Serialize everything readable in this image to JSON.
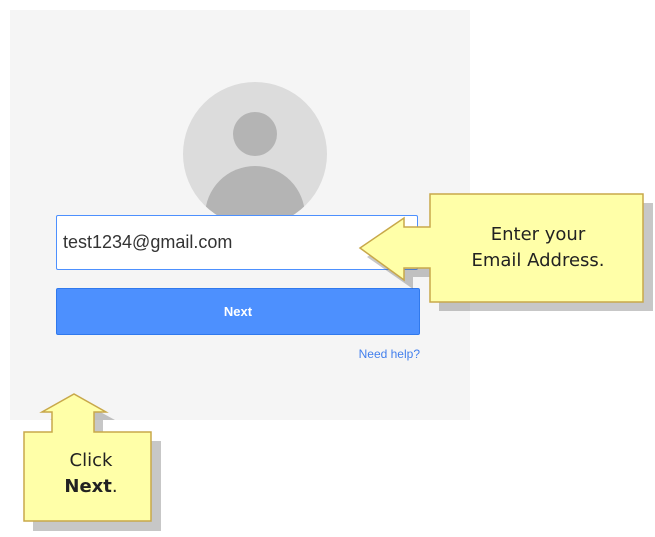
{
  "login": {
    "email_value": "test1234@gmail.com",
    "next_label": "Next",
    "help_label": "Need help?"
  },
  "callouts": {
    "email_hint_line1": "Enter your",
    "email_hint_line2": "Email Address.",
    "next_hint_line1": "Click",
    "next_hint_bold": "Next",
    "next_hint_end": "."
  },
  "colors": {
    "card_background": "#f5f5f5",
    "button_blue": "#4d90fe",
    "link_blue": "#427fed",
    "callout_fill": "#ffffa8"
  }
}
